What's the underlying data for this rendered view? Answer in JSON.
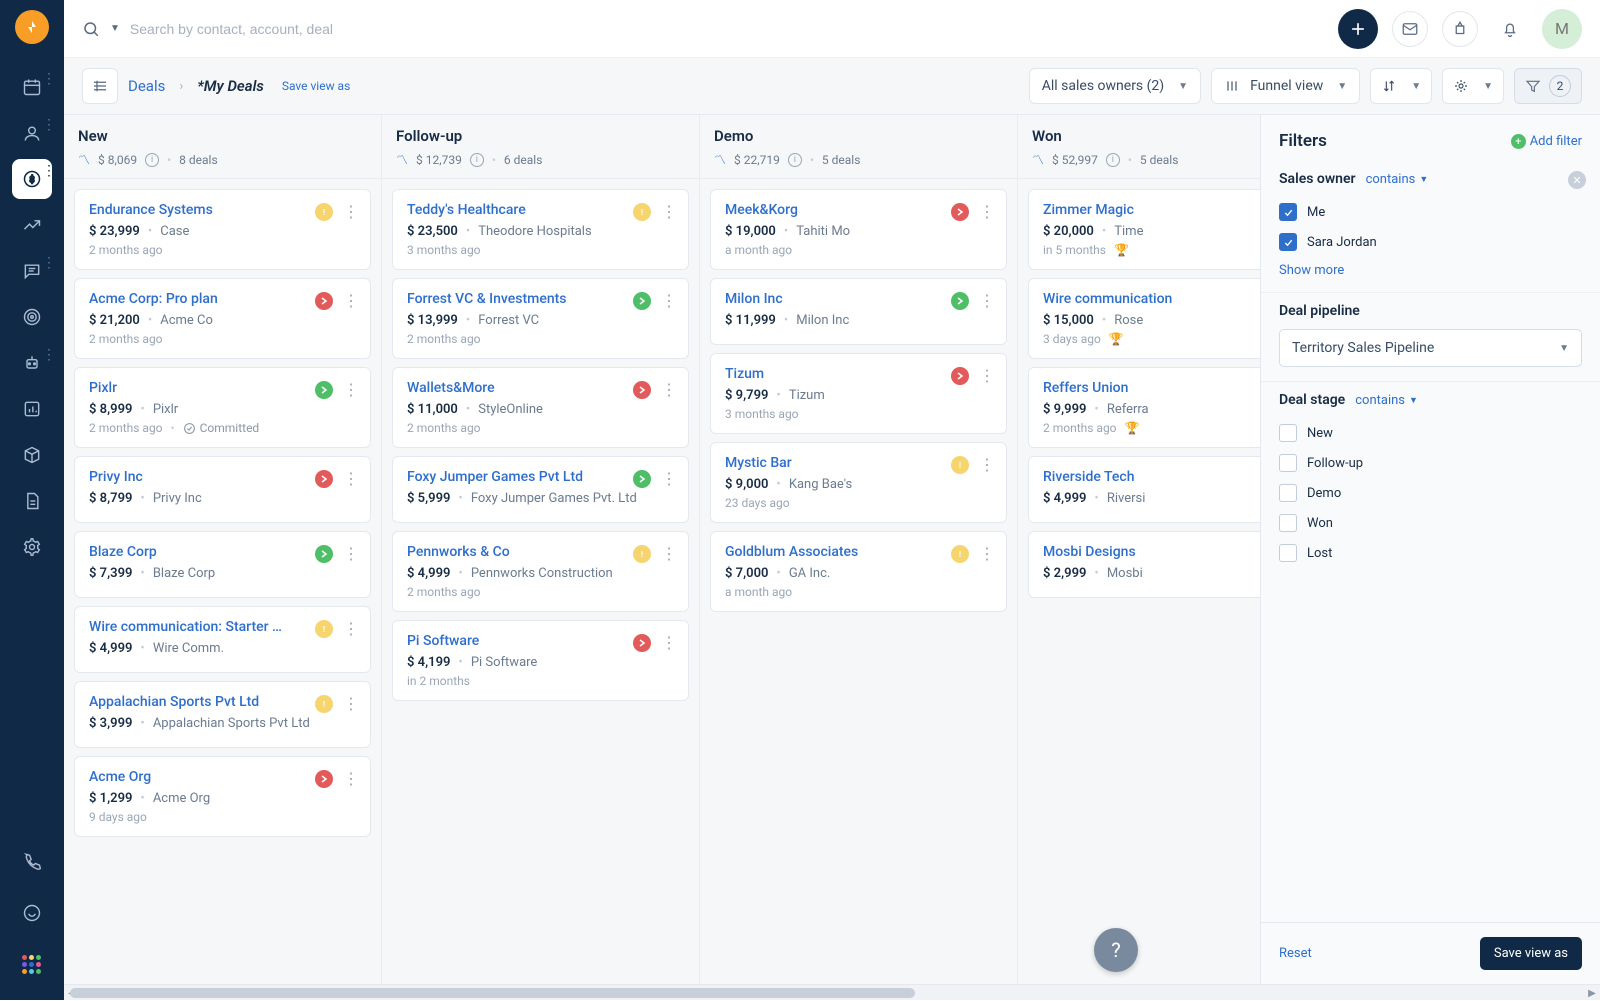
{
  "search_placeholder": "Search by contact, account, deal",
  "avatar_initial": "M",
  "breadcrumb": {
    "deals": "Deals",
    "current": "*My Deals",
    "save": "Save view as"
  },
  "toolbar": {
    "owners": "All sales owners (2)",
    "view": "Funnel view",
    "filter_count": "2"
  },
  "columns": [
    {
      "name": "New",
      "total": "$ 8,069",
      "count": "8 deals",
      "cards": [
        {
          "title": "Endurance Systems",
          "amount": "$ 23,999",
          "acct": "Case",
          "time": "2 months ago",
          "status": "warn"
        },
        {
          "title": "Acme Corp: Pro plan",
          "amount": "$ 21,200",
          "acct": "Acme Co",
          "time": "2 months ago",
          "status": "red"
        },
        {
          "title": "Pixlr",
          "amount": "$ 8,999",
          "acct": "Pixlr",
          "time": "2 months ago",
          "status": "green",
          "committed": "Committed"
        },
        {
          "title": "Privy Inc",
          "amount": "$ 8,799",
          "acct": "Privy Inc",
          "time": "",
          "status": "red"
        },
        {
          "title": "Blaze Corp",
          "amount": "$ 7,399",
          "acct": "Blaze Corp",
          "time": "",
          "status": "green"
        },
        {
          "title": "Wire communication: Starter …",
          "amount": "$ 4,999",
          "acct": "Wire Comm.",
          "time": "",
          "status": "warn"
        },
        {
          "title": "Appalachian Sports Pvt Ltd",
          "amount": "$ 3,999",
          "acct": "Appalachian Sports Pvt Ltd",
          "time": "",
          "status": "warn"
        },
        {
          "title": "Acme Org",
          "amount": "$ 1,299",
          "acct": "Acme Org",
          "time": "9 days ago",
          "status": "red"
        }
      ]
    },
    {
      "name": "Follow-up",
      "total": "$ 12,739",
      "count": "6 deals",
      "cards": [
        {
          "title": "Teddy's Healthcare",
          "amount": "$ 23,500",
          "acct": "Theodore Hospitals",
          "time": "3 months ago",
          "status": "warn"
        },
        {
          "title": "Forrest VC & Investments",
          "amount": "$ 13,999",
          "acct": "Forrest VC",
          "time": "2 months ago",
          "status": "green"
        },
        {
          "title": "Wallets&More",
          "amount": "$ 11,000",
          "acct": "StyleOnline",
          "time": "2 months ago",
          "status": "red"
        },
        {
          "title": "Foxy Jumper Games Pvt Ltd",
          "amount": "$ 5,999",
          "acct": "Foxy Jumper Games Pvt. Ltd",
          "time": "",
          "status": "green"
        },
        {
          "title": "Pennworks & Co",
          "amount": "$ 4,999",
          "acct": "Pennworks Construction",
          "time": "2 months ago",
          "status": "warn"
        },
        {
          "title": "Pi Software",
          "amount": "$ 4,199",
          "acct": "Pi Software",
          "time": "in 2 months",
          "status": "red"
        }
      ]
    },
    {
      "name": "Demo",
      "total": "$ 22,719",
      "count": "5 deals",
      "cards": [
        {
          "title": "Meek&Korg",
          "amount": "$ 19,000",
          "acct": "Tahiti Mo",
          "time": "a month ago",
          "status": "red"
        },
        {
          "title": "Milon Inc",
          "amount": "$ 11,999",
          "acct": "Milon Inc",
          "time": "",
          "status": "green"
        },
        {
          "title": "Tizum",
          "amount": "$ 9,799",
          "acct": "Tizum",
          "time": "3 months ago",
          "status": "red"
        },
        {
          "title": "Mystic Bar",
          "amount": "$ 9,000",
          "acct": "Kang Bae's",
          "time": "23 days ago",
          "status": "warn"
        },
        {
          "title": "Goldblum Associates",
          "amount": "$ 7,000",
          "acct": "GA Inc.",
          "time": "a month ago",
          "status": "warn"
        }
      ]
    },
    {
      "name": "Won",
      "total": "$ 52,997",
      "count": "5 deals",
      "cards": [
        {
          "title": "Zimmer Magic",
          "amount": "$ 20,000",
          "acct": "Time",
          "time": "in 5 months",
          "status": "",
          "trophy": true
        },
        {
          "title": "Wire communication",
          "amount": "$ 15,000",
          "acct": "Rose",
          "time": "3 days ago",
          "status": "",
          "trophy": true
        },
        {
          "title": "Reffers Union",
          "amount": "$ 9,999",
          "acct": "Referra",
          "time": "2 months ago",
          "status": "",
          "trophy": true
        },
        {
          "title": "Riverside Tech",
          "amount": "$ 4,999",
          "acct": "Riversi",
          "time": "",
          "status": ""
        },
        {
          "title": "Mosbi Designs",
          "amount": "$ 2,999",
          "acct": "Mosbi",
          "time": "",
          "status": ""
        }
      ]
    }
  ],
  "filters": {
    "title": "Filters",
    "add": "Add filter",
    "owner": {
      "label": "Sales owner",
      "op": "contains",
      "items": [
        "Me",
        "Sara Jordan"
      ],
      "more": "Show more"
    },
    "pipeline": {
      "label": "Deal pipeline",
      "value": "Territory Sales Pipeline"
    },
    "stage": {
      "label": "Deal stage",
      "op": "contains",
      "items": [
        "New",
        "Follow-up",
        "Demo",
        "Won",
        "Lost"
      ]
    },
    "reset": "Reset",
    "save": "Save view as"
  }
}
